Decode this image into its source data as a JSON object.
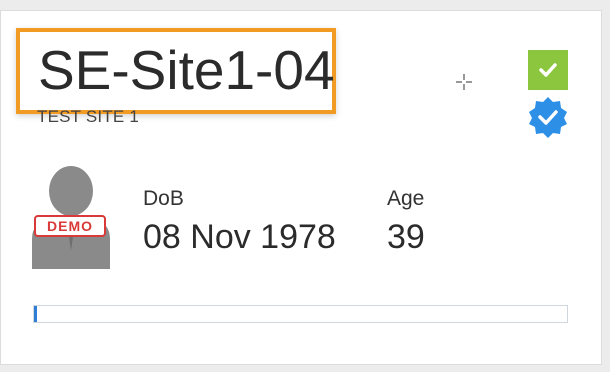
{
  "card": {
    "subject_id": "SE-Site1-04",
    "site_name": "TEST SITE 1",
    "demo_badge": "DEMO",
    "dob_label": "DoB",
    "dob_value": "08 Nov 1978",
    "age_label": "Age",
    "age_value": "39",
    "progress_fraction": 0.006
  },
  "icons": {
    "status": "check-icon",
    "verified": "verified-badge-icon",
    "avatar": "person-avatar-icon",
    "cursor": "crosshair-cursor-icon"
  },
  "colors": {
    "highlight_border": "#f19a24",
    "check_green": "#8cc63f",
    "verified_blue": "#2e8fe6",
    "demo_red": "#d93939",
    "progress_blue": "#2f7fd6"
  }
}
